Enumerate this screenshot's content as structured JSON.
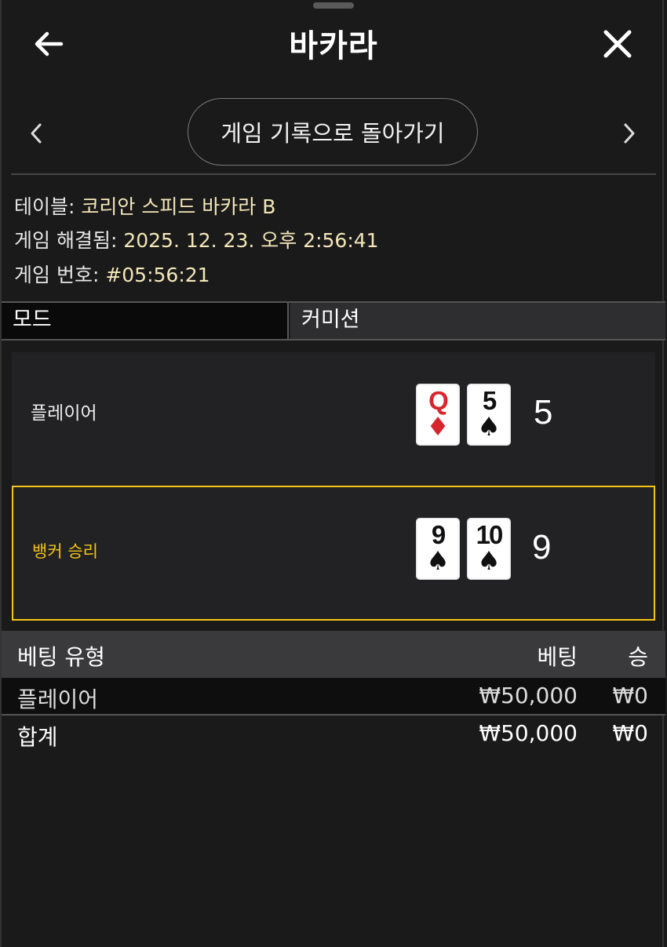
{
  "header": {
    "title": "바카라"
  },
  "nav": {
    "back_to_history": "게임 기록으로 돌아가기"
  },
  "info": {
    "table_label": "테이블: ",
    "table_value": "코리안 스피드 바카라 B",
    "resolved_label": "게임 해결됨: ",
    "resolved_value": "2025. 12. 23. 오후 2:56:41",
    "game_no_label": "게임 번호: ",
    "game_no_value": "#05:56:21"
  },
  "mode": {
    "label": "모드",
    "value": "커미션"
  },
  "results": {
    "player": {
      "label": "플레이어",
      "score": "5",
      "cards": [
        {
          "rank": "Q",
          "suit": "♦"
        },
        {
          "rank": "5",
          "suit": "♠"
        }
      ]
    },
    "banker": {
      "label": "뱅커 승리",
      "score": "9",
      "cards": [
        {
          "rank": "9",
          "suit": "♠"
        },
        {
          "rank": "10",
          "suit": "♠"
        }
      ]
    }
  },
  "bets": {
    "headers": {
      "type": "베팅 유형",
      "bet": "베팅",
      "win": "승"
    },
    "rows": [
      {
        "type": "플레이어",
        "bet": "₩50,000",
        "win": "₩0"
      }
    ],
    "total": {
      "label": "합계",
      "bet": "₩50,000",
      "win": "₩0"
    }
  },
  "colors": {
    "accent_yellow": "#f3c511",
    "card_red": "#d6262c",
    "background": "#1a1a1b"
  }
}
